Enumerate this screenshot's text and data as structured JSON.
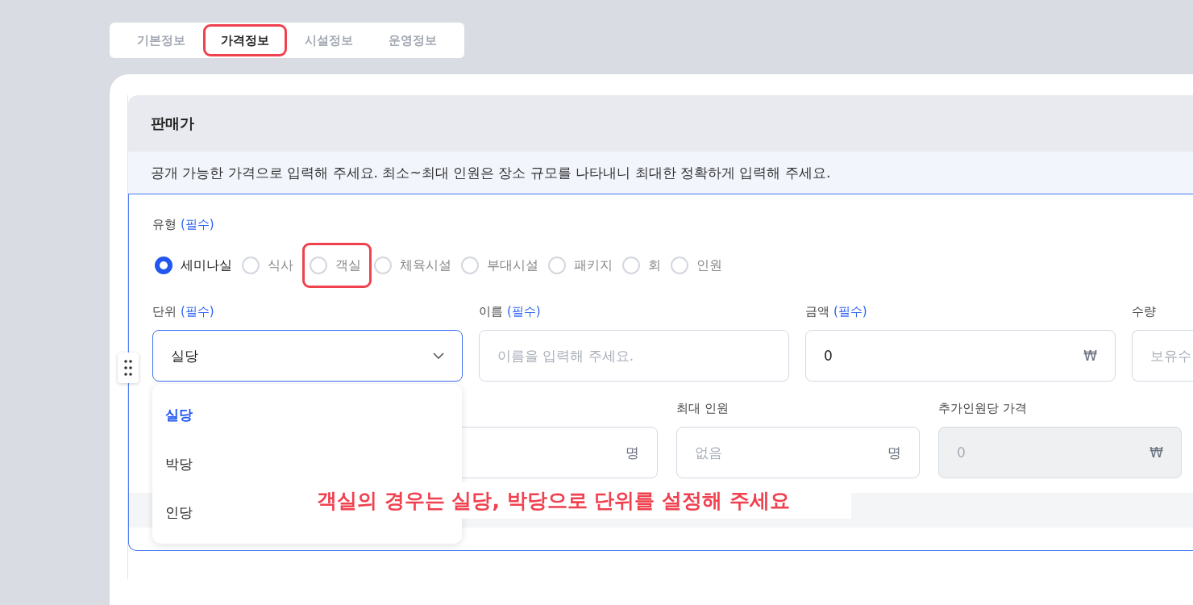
{
  "tabs": [
    {
      "label": "기본정보",
      "selected": false,
      "highlighted": false
    },
    {
      "label": "가격정보",
      "selected": true,
      "highlighted": true
    },
    {
      "label": "시설정보",
      "selected": false,
      "highlighted": false
    },
    {
      "label": "운영정보",
      "selected": false,
      "highlighted": false
    }
  ],
  "section": {
    "title": "판매가",
    "notice": "공개 가능한 가격으로 입력해 주세요. 최소~최대 인원은 장소 규모를 나타내니 최대한 정확하게 입력해 주세요."
  },
  "type_field": {
    "label": "유형",
    "required": "(필수)",
    "options": [
      {
        "label": "세미나실",
        "selected": true,
        "highlighted": false
      },
      {
        "label": "식사",
        "selected": false,
        "highlighted": false
      },
      {
        "label": "객실",
        "selected": false,
        "highlighted": true
      },
      {
        "label": "체육시설",
        "selected": false,
        "highlighted": false
      },
      {
        "label": "부대시설",
        "selected": false,
        "highlighted": false
      },
      {
        "label": "패키지",
        "selected": false,
        "highlighted": false
      },
      {
        "label": "회",
        "selected": false,
        "highlighted": false
      },
      {
        "label": "인원",
        "selected": false,
        "highlighted": false
      }
    ]
  },
  "fields_row_1": [
    {
      "kind": "select",
      "label": "단위",
      "required": "(필수)",
      "value": "실당",
      "focused": true
    },
    {
      "kind": "text",
      "label": "이름",
      "required": "(필수)",
      "placeholder": "이름을 입력해 주세요."
    },
    {
      "kind": "text",
      "label": "금액",
      "required": "(필수)",
      "value": "0",
      "unit": "₩"
    },
    {
      "kind": "text",
      "label": "수량",
      "placeholder": "보유수"
    }
  ],
  "fields_row_2": [
    {
      "kind": "text",
      "unit": "명"
    },
    {
      "kind": "text",
      "label": "최대 인원",
      "placeholder": "없음",
      "unit": "명"
    },
    {
      "kind": "text",
      "label": "추가인원당 가격",
      "placeholder": "0",
      "unit": "₩",
      "disabled": true
    }
  ],
  "dropdown": {
    "options": [
      {
        "label": "실당",
        "selected": true
      },
      {
        "label": "박당",
        "selected": false
      },
      {
        "label": "인당",
        "selected": false
      }
    ]
  },
  "annotation_note": "객실의 경우는 실당, 박당으로 단위를 설정해 주세요"
}
